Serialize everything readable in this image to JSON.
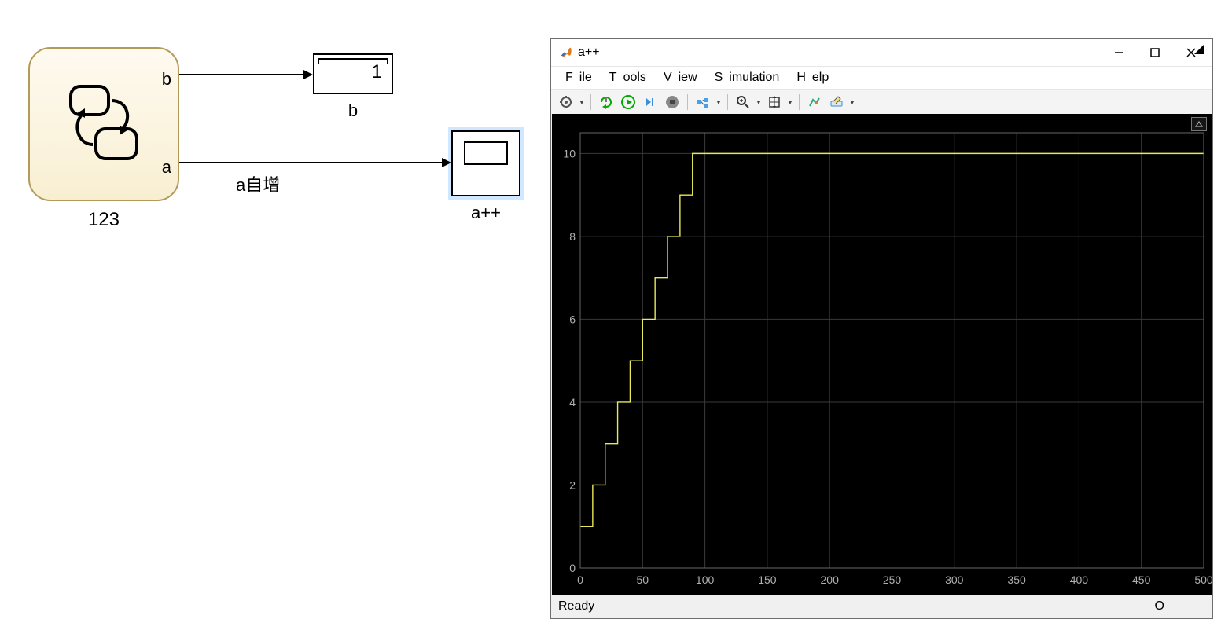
{
  "diagram": {
    "chart_block_label": "123",
    "port_b": "b",
    "port_a": "a",
    "display_value": "1",
    "display_label": "b",
    "scope_label": "a++",
    "signal_a_label": "a自增"
  },
  "scope_window": {
    "title": "a++",
    "menus": {
      "file": "File",
      "tools": "Tools",
      "view": "View",
      "simulation": "Simulation",
      "help": "Help"
    },
    "status": "Ready",
    "status_right": "O"
  },
  "chart_data": {
    "type": "line",
    "title": "",
    "xlabel": "",
    "ylabel": "",
    "xlim": [
      0,
      500
    ],
    "ylim": [
      0,
      10.5
    ],
    "x_ticks": [
      0,
      50,
      100,
      150,
      200,
      250,
      300,
      350,
      400,
      450,
      500
    ],
    "y_ticks": [
      0,
      2,
      4,
      6,
      8,
      10
    ],
    "x": [
      0,
      10,
      10,
      20,
      20,
      30,
      30,
      40,
      40,
      50,
      50,
      60,
      60,
      70,
      70,
      80,
      80,
      90,
      90,
      100,
      100,
      500
    ],
    "y": [
      1,
      1,
      2,
      2,
      3,
      3,
      4,
      4,
      5,
      5,
      6,
      6,
      7,
      7,
      8,
      8,
      9,
      9,
      10,
      10,
      10,
      10
    ]
  }
}
